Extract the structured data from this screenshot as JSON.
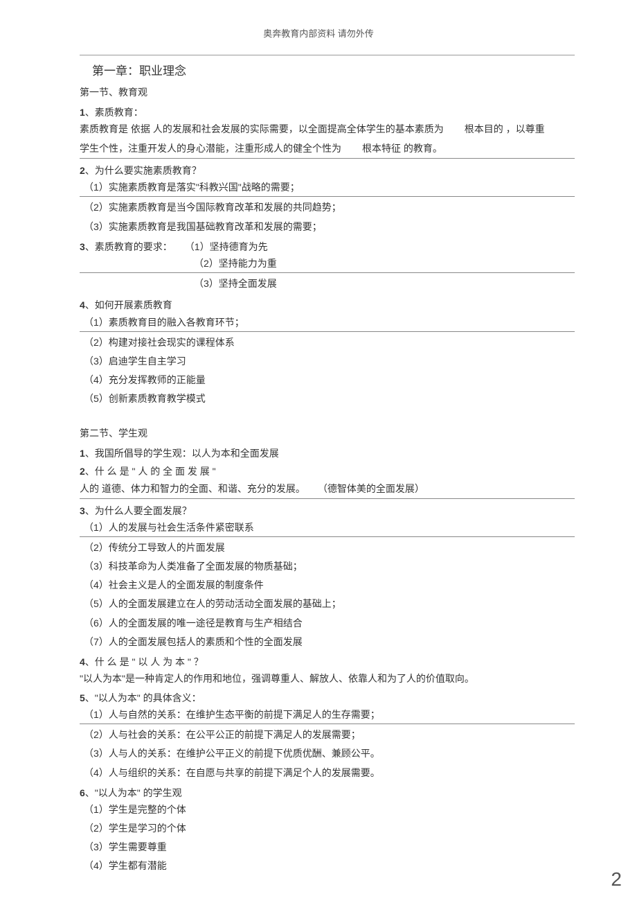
{
  "header": "奥奔教育内部资料  请勿外传",
  "chapter_title": "第一章：职业理念",
  "section1": {
    "title": "第一节、教育观",
    "q1": {
      "num": "1",
      "heading": "、素质教育：",
      "text_a": "素质教育是  依据 人的发展和社会发展的实际需要，以全面提高全体学生的基本素质为",
      "text_b": "根本目的 ，以尊重",
      "text_c": "学生个性，注重开发人的身心潜能，注重形成人的健全个性为",
      "text_d": "根本特征  的教育。"
    },
    "q2": {
      "num": "2",
      "heading": "、为什么要实施素质教育？",
      "items": [
        "（1）实施素质教育是落实\"科教兴国\"战略的需要；",
        "（2）实施素质教育是当今国际教育改革和发展的共同趋势；",
        "（3）实施素质教育是我国基础教育改革和发展的需要；"
      ]
    },
    "q3": {
      "num": "3",
      "heading": "、素质教育的要求：",
      "items": [
        "（1）坚持德育为先",
        "（2）坚持能力为重",
        "（3）坚持全面发展"
      ]
    },
    "q4": {
      "num": "4",
      "heading": "、如何开展素质教育",
      "items": [
        "（1）素质教育目的融入各教育环节；",
        "（2）构建对接社会现实的课程体系",
        "（3）启迪学生自主学习",
        "（4）充分发挥教师的正能量",
        "（5）创新素质教育教学模式"
      ]
    }
  },
  "section2": {
    "title": "第二节、学生观",
    "q1": {
      "num": "1",
      "text": "、我国所倡导的学生观：以人为本和全面发展"
    },
    "q2": {
      "num": "2",
      "heading": "、什 么 是 \" 人 的 全 面 发 展 \"",
      "text_a": "人的 道德、体力和智力的全面、和谐、充分的发展。",
      "text_b": "（德智体美的全面发展）"
    },
    "q3": {
      "num": "3",
      "heading": "、为什么人要全面发展？",
      "items": [
        "（1）人的发展与社会生活条件紧密联系",
        "（2）传统分工导致人的片面发展",
        "（3）科技革命为人类准备了全面发展的物质基础；",
        "（4）社会主义是人的全面发展的制度条件",
        "（5）人的全面发展建立在人的劳动活动全面发展的基础上；",
        "（6）人的全面发展的唯一途径是教育与生产相结合",
        "（7）人的全面发展包括人的素质和个性的全面发展"
      ]
    },
    "q4": {
      "num": "4",
      "heading": "、什 么 是 \" 以 人 为 本 \" ？",
      "text": "\"以人为本\"是一种肯定人的作用和地位，强调尊重人、解放人、依靠人和为了人的价值取向。"
    },
    "q5": {
      "num": "5",
      "heading": "、\"以人为本\" 的具体含义：",
      "items": [
        "（1）人与自然的关系：在维护生态平衡的前提下满足人的生存需要；",
        "（2）人与社会的关系：在公平公正的前提下满足人的发展需要；",
        "（3）人与人的关系：在维护公平正义的前提下优质优酬、兼顾公平。",
        "（4）人与组织的关系：在自愿与共享的前提下满足个人的发展需要。"
      ]
    },
    "q6": {
      "num": "6",
      "heading": "、\"以人为本\" 的学生观",
      "items": [
        "（1）学生是完整的个体",
        "（2）学生是学习的个体",
        "（3）学生需要尊重",
        "（4）学生都有潜能"
      ]
    }
  },
  "page_number": "2"
}
